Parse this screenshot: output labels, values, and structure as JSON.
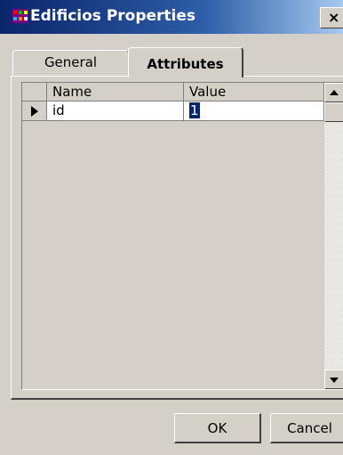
{
  "window": {
    "title": "Edificios Properties",
    "close_glyph": "×"
  },
  "tabs": [
    {
      "label": "General",
      "selected": false
    },
    {
      "label": "Attributes",
      "selected": true
    }
  ],
  "grid": {
    "columns": [
      "Name",
      "Value"
    ],
    "rows": [
      {
        "name": "id",
        "value": "1",
        "current": true
      }
    ]
  },
  "buttons": {
    "ok_label": "OK",
    "cancel_label": "Cancel"
  },
  "icons": {
    "app": "app-icon",
    "row_indicator": "row-pointer-icon",
    "scroll_up": "scroll-up-arrow-icon",
    "scroll_down": "scroll-down-arrow-icon"
  },
  "colors": {
    "title_bar_start": "#0a246a",
    "title_bar_end": "#a6caf0",
    "face": "#d4d0c8",
    "selection": "#0a246a"
  }
}
